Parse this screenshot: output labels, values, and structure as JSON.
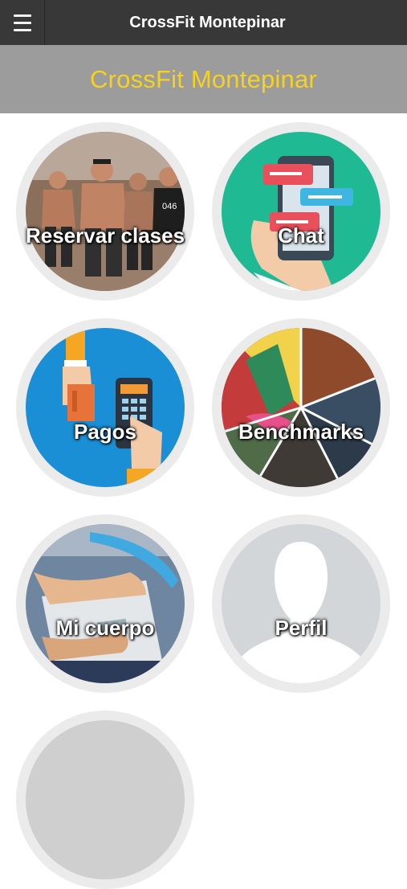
{
  "header": {
    "title": "CrossFit Montepinar",
    "menu_icon": "hamburger-menu-icon"
  },
  "banner": {
    "title": "CrossFit Montepinar",
    "title_color": "#f6d21e"
  },
  "tiles": [
    {
      "label": "Reservar clases",
      "icon": "athletes-running-photo"
    },
    {
      "label": "Chat",
      "icon": "chat-bubbles-phone-icon"
    },
    {
      "label": "Pagos",
      "icon": "card-payment-terminal-icon"
    },
    {
      "label": "Benchmarks",
      "icon": "sports-collage-photo"
    },
    {
      "label": "Mi cuerpo",
      "icon": "bathroom-scale-photo"
    },
    {
      "label": "Perfil",
      "icon": "profile-silhouette-icon"
    }
  ],
  "colors": {
    "topbar": "#383838",
    "banner": "#9c9c9c",
    "tile_ring": "#ebebeb",
    "chat_bg": "#1fba94",
    "pagos_bg": "#1a8fd6"
  }
}
